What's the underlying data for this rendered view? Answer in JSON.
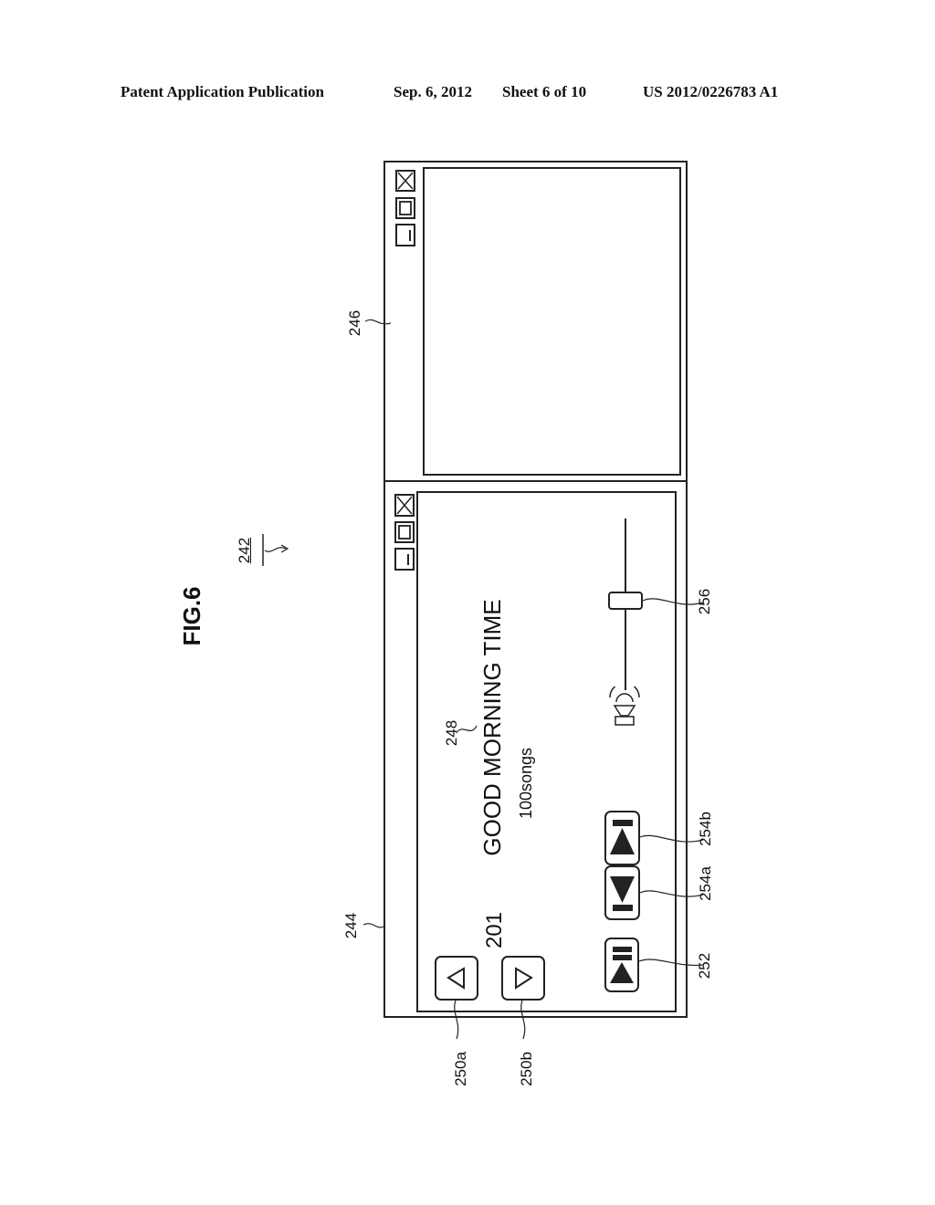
{
  "header": {
    "publication": "Patent Application Publication",
    "date": "Sep. 6, 2012",
    "sheet": "Sheet 6 of 10",
    "number": "US 2012/0226783 A1"
  },
  "figure": {
    "title": "FIG.6",
    "ref_screen": "242"
  },
  "windows": {
    "left_window": {
      "ref": "244"
    },
    "right_window": {
      "ref": "246"
    }
  },
  "player": {
    "track_number": "201",
    "playlist_title": "GOOD MORNING TIME",
    "song_count": "100songs",
    "title_ref": "248",
    "prev_button_ref": "250a",
    "next_button_ref": "250b",
    "play_pause_ref": "252",
    "rewind_ref": "254a",
    "forward_ref": "254b",
    "volume_slider_ref": "256",
    "volume_level": 0.45
  },
  "icons": {
    "window_close": "close-icon",
    "window_maximize": "maximize-icon",
    "window_minimize": "minimize-icon",
    "prev": "triangle-left-icon",
    "next": "triangle-right-icon",
    "play_pause": "play-pause-icon",
    "rewind": "skip-back-icon",
    "forward": "skip-forward-icon",
    "speaker": "speaker-icon"
  }
}
